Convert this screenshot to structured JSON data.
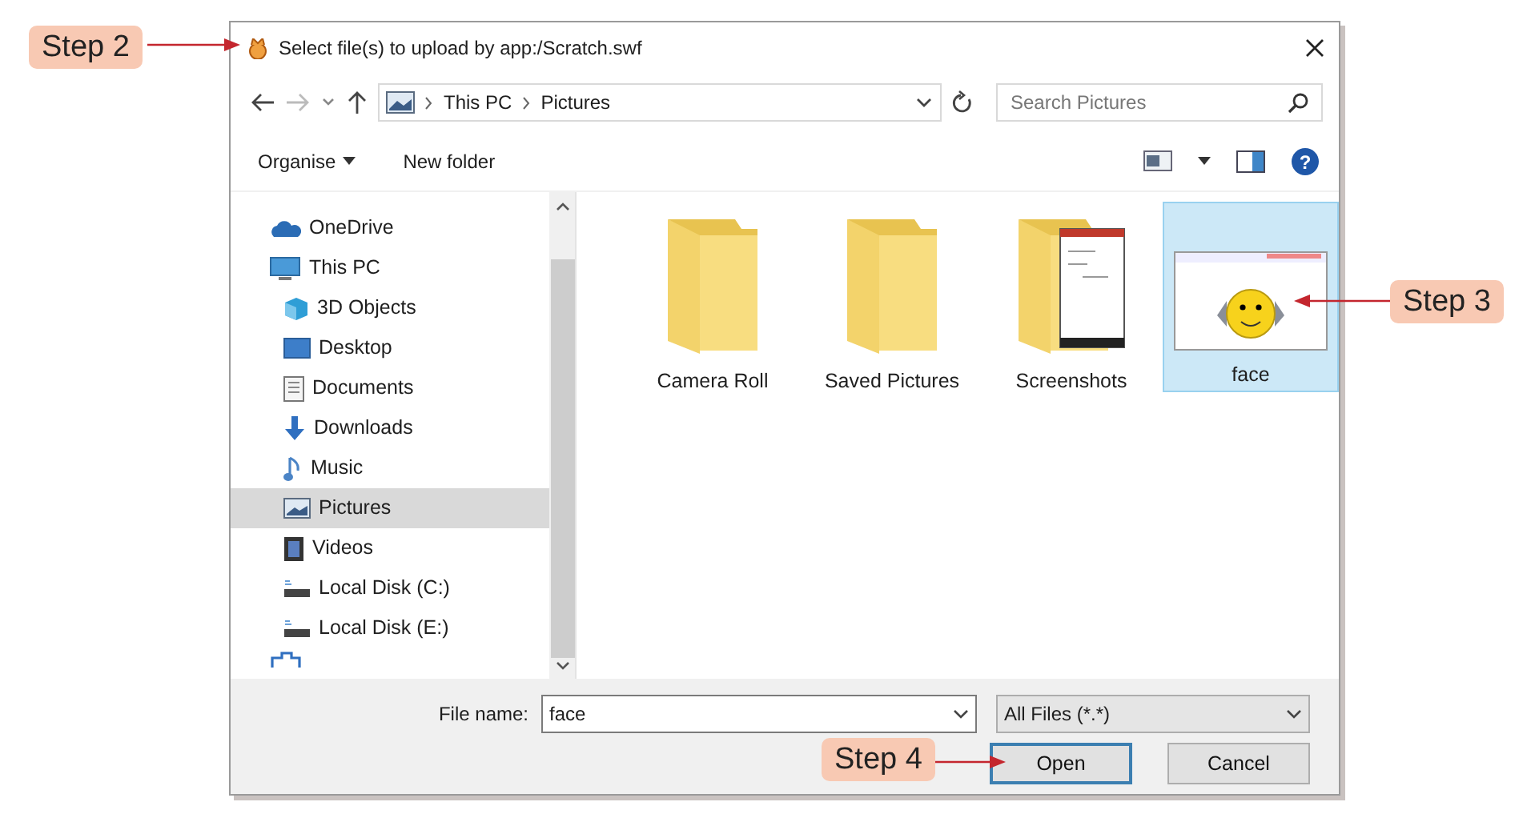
{
  "callouts": [
    {
      "label": "Step 2"
    },
    {
      "label": "Step 3"
    },
    {
      "label": "Step 4"
    }
  ],
  "window": {
    "title": "Select file(s) to upload by app:/Scratch.swf"
  },
  "address_bar": {
    "path": [
      "This PC",
      "Pictures"
    ]
  },
  "search": {
    "placeholder": "Search Pictures"
  },
  "toolbar": {
    "help_glyph": "?",
    "items": [
      {
        "label": "Organise",
        "dropdown": true
      },
      {
        "label": "New folder",
        "dropdown": false
      }
    ]
  },
  "sidebar": {
    "items": [
      {
        "label": "OneDrive",
        "kind": "cloud",
        "selected": false
      },
      {
        "label": "This PC",
        "kind": "pc",
        "selected": false,
        "children": [
          {
            "label": "3D Objects",
            "kind": "cube",
            "selected": false
          },
          {
            "label": "Desktop",
            "kind": "desktop",
            "selected": false
          },
          {
            "label": "Documents",
            "kind": "documents",
            "selected": false
          },
          {
            "label": "Downloads",
            "kind": "downloads",
            "selected": false
          },
          {
            "label": "Music",
            "kind": "music",
            "selected": false
          },
          {
            "label": "Pictures",
            "kind": "pictures",
            "selected": true
          },
          {
            "label": "Videos",
            "kind": "videos",
            "selected": false
          },
          {
            "label": "Local Disk (C:)",
            "kind": "disk",
            "selected": false
          },
          {
            "label": "Local Disk (E:)",
            "kind": "disk",
            "selected": false
          }
        ]
      },
      {
        "kind": "network",
        "selected": false
      }
    ]
  },
  "files": [
    {
      "name": "Camera Roll",
      "kind": "folder",
      "selected": false
    },
    {
      "name": "Saved Pictures",
      "kind": "folder",
      "selected": false
    },
    {
      "name": "Screenshots",
      "kind": "screenshots",
      "selected": false
    },
    {
      "name": "face",
      "kind": "image",
      "selected": true
    }
  ],
  "footer": {
    "file_name_label": "File name:",
    "file_name_value": "face",
    "file_type": "All Files (*.*)",
    "buttons": [
      {
        "label": "Open",
        "default": true
      },
      {
        "label": "Cancel",
        "default": false
      }
    ]
  }
}
